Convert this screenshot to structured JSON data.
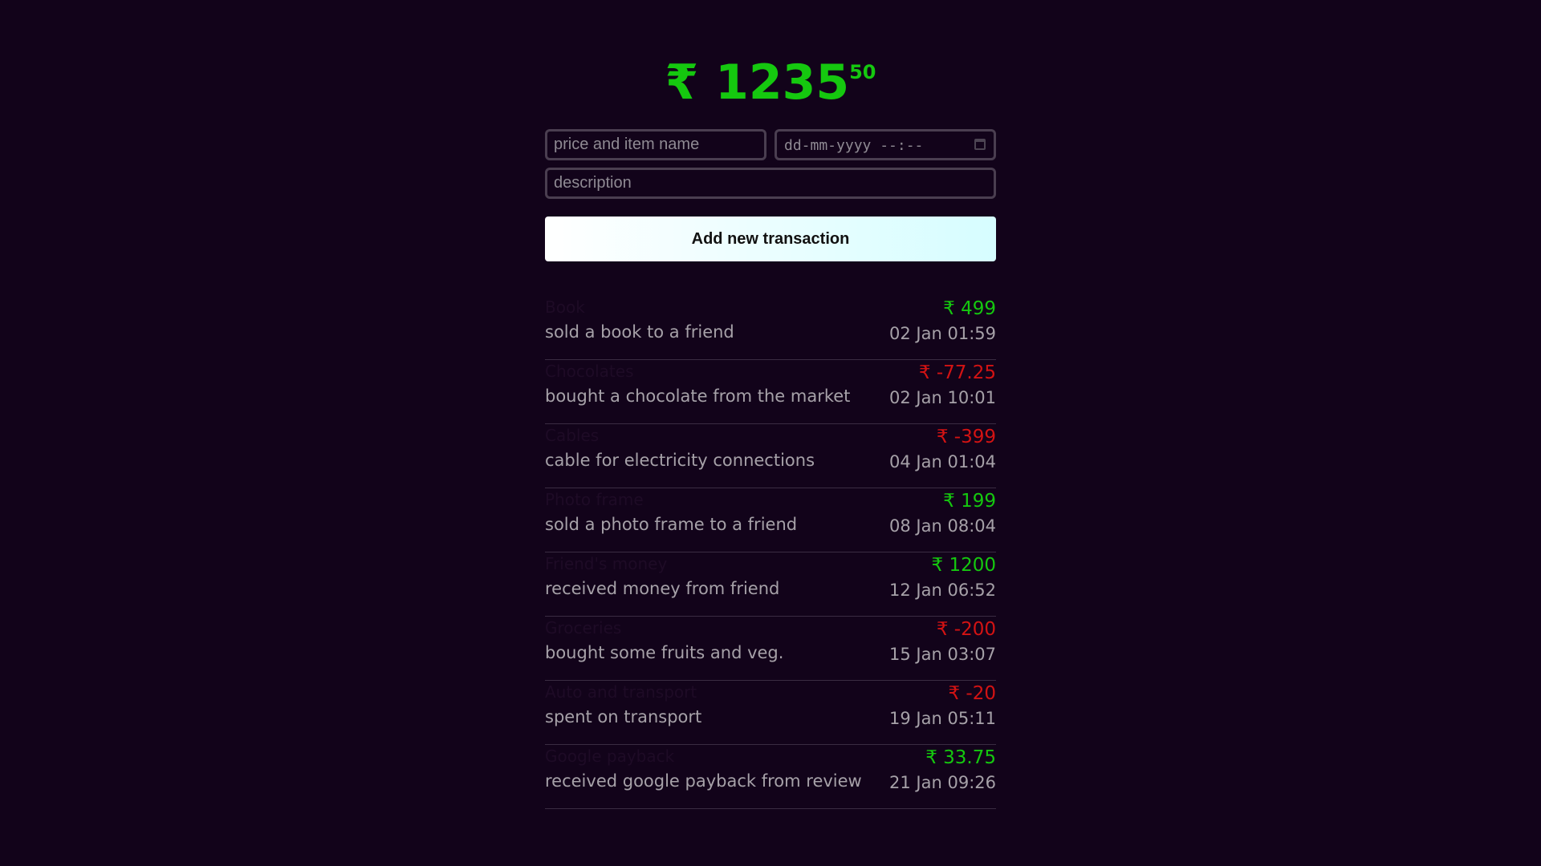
{
  "colors": {
    "background": "#12031a",
    "positive": "#15c80f",
    "negative": "#d31313",
    "muted_text": "#a6a1a8"
  },
  "balance": {
    "currency": "₹",
    "whole": "1235",
    "fraction": "50"
  },
  "form": {
    "name_placeholder": "price and item name",
    "date_placeholder": "dd-mm-yyyy --:--",
    "description_placeholder": "description",
    "submit_label": "Add new transaction"
  },
  "transactions": [
    {
      "name": "Book",
      "description": "sold a book to a friend",
      "price": "₹ 499",
      "sign": "pos",
      "date": "02 Jan 01:59"
    },
    {
      "name": "Chocolates",
      "description": "bought a chocolate from the market",
      "price": "₹ -77.25",
      "sign": "neg",
      "date": "02 Jan 10:01"
    },
    {
      "name": "Cables",
      "description": "cable for electricity connections",
      "price": "₹ -399",
      "sign": "neg",
      "date": "04 Jan 01:04"
    },
    {
      "name": "Photo frame",
      "description": "sold a photo frame to a friend",
      "price": "₹ 199",
      "sign": "pos",
      "date": "08 Jan 08:04"
    },
    {
      "name": "Friend's money",
      "description": "received money from friend",
      "price": "₹ 1200",
      "sign": "pos",
      "date": "12 Jan 06:52"
    },
    {
      "name": "Groceries",
      "description": "bought some fruits and veg.",
      "price": "₹ -200",
      "sign": "neg",
      "date": "15 Jan 03:07"
    },
    {
      "name": "Auto and transport",
      "description": "spent on transport",
      "price": "₹ -20",
      "sign": "neg",
      "date": "19 Jan 05:11"
    },
    {
      "name": "Google payback",
      "description": "received google payback from review",
      "price": "₹ 33.75",
      "sign": "pos",
      "date": "21 Jan 09:26"
    }
  ]
}
